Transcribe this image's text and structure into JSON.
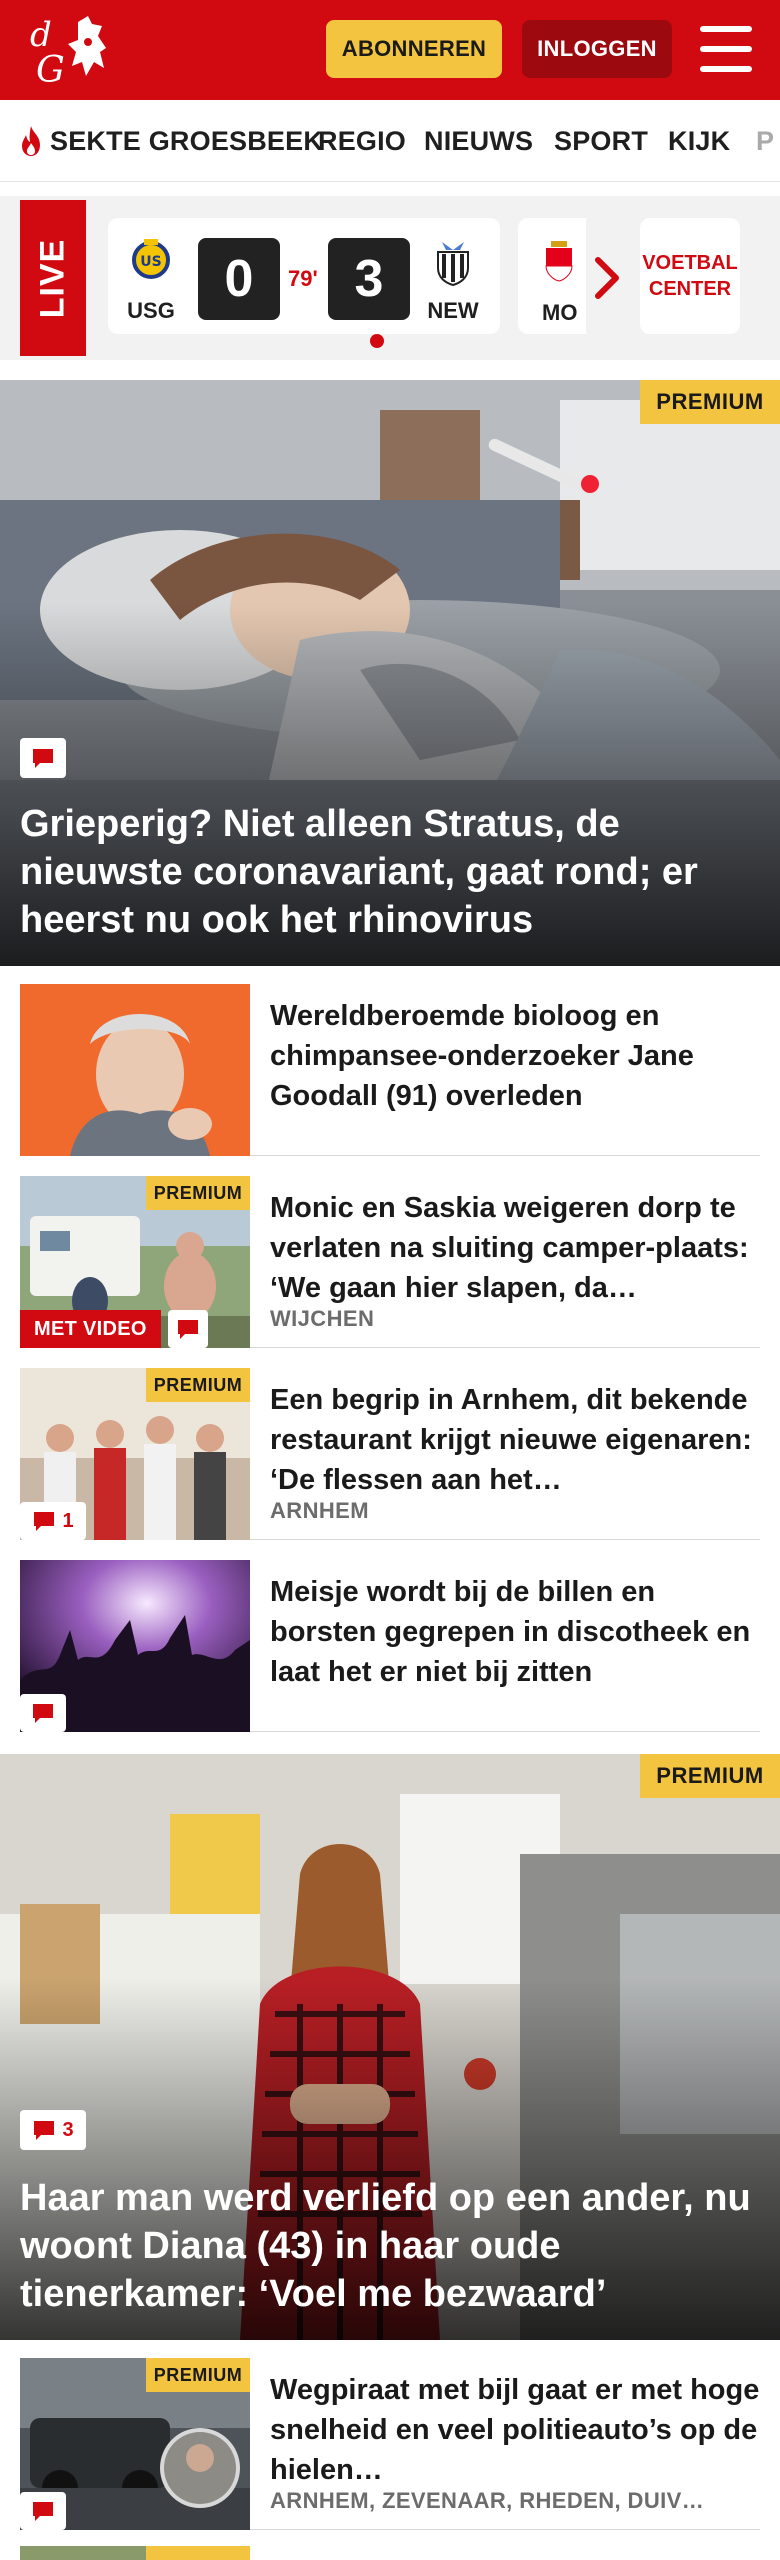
{
  "header": {
    "subscribe_label": "ABONNEREN",
    "login_label": "INLOGGEN",
    "brand_color": "#d10a11",
    "accent_color": "#f3c43f"
  },
  "nav": {
    "items": [
      "SEKTE GROESBEEK",
      "REGIO",
      "NIEUWS",
      "SPORT",
      "KIJK",
      "P"
    ]
  },
  "live": {
    "badge": "LIVE",
    "match": {
      "home": "USG",
      "away": "NEW",
      "home_score": "0",
      "away_score": "3",
      "minute": "79'"
    },
    "next_team": "MO",
    "voetbal_center_line1": "VOETBAL",
    "voetbal_center_line2": "CENTER"
  },
  "hero1": {
    "premium": "PREMIUM",
    "title": "Grieperig? Niet alleen Stratus, de nieuwste coronavariant, gaat rond; er heerst nu ook het rhinovirus"
  },
  "articles": [
    {
      "title": "Wereldberoemde bioloog en chimpansee-onderzoeker Jane Goodall (91) overleden",
      "meta": ""
    },
    {
      "premium": "PREMIUM",
      "title": "Monic en Saskia weigeren dorp te verlaten na sluiting camper-plaats: ‘We gaan hier slapen, da…",
      "meta": "WIJCHEN",
      "video_label": "MET VIDEO"
    },
    {
      "premium": "PREMIUM",
      "title": "Een begrip in Arnhem, dit bekende restaurant krijgt nieuwe eigenaren: ‘De flessen aan het…",
      "meta": "ARNHEM",
      "comments": "1"
    },
    {
      "title": "Meisje wordt bij de billen en borsten gegrepen in discotheek en laat het er niet bij zitten",
      "meta": ""
    }
  ],
  "hero2": {
    "premium": "PREMIUM",
    "comments": "3",
    "title": "Haar man werd verliefd op een ander, nu woont Diana (43) in haar oude tienerkamer: ‘Voel me bezwaard’"
  },
  "article_last": {
    "premium": "PREMIUM",
    "title": "Wegpiraat met bijl gaat er met hoge snelheid en veel politieauto’s op de hielen…",
    "meta": "ARNHEM, ZEVENAAR, RHEDEN, DUIV…"
  },
  "icons": [
    "flame-icon",
    "menu-icon",
    "comment-icon",
    "chevron-right-icon",
    "usg-crest-icon",
    "newcastle-crest-icon",
    "monaco-crest-icon"
  ]
}
